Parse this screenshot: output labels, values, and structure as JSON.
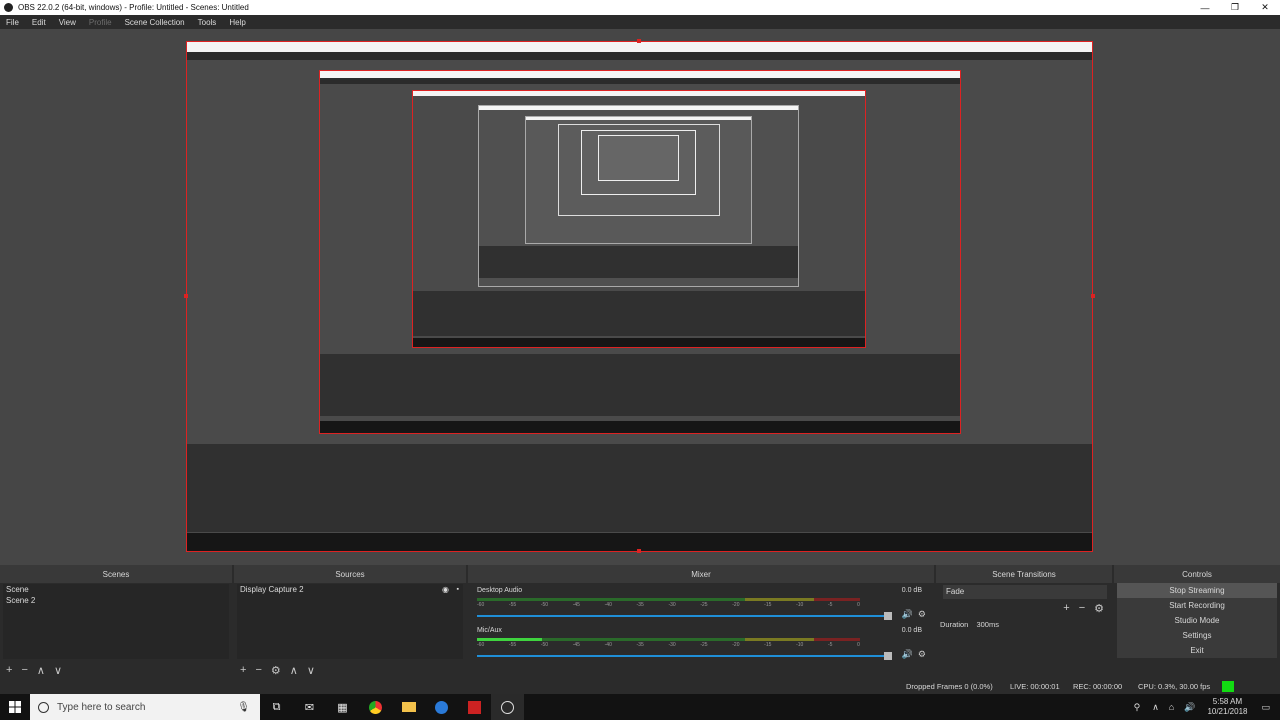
{
  "window": {
    "title": "OBS 22.0.2 (64-bit, windows) - Profile: Untitled - Scenes: Untitled",
    "minimize": "—",
    "maximize": "❐",
    "close": "✕"
  },
  "menu": {
    "file": "File",
    "edit": "Edit",
    "view": "View",
    "profile": "Profile",
    "scene_collection": "Scene Collection",
    "tools": "Tools",
    "help": "Help"
  },
  "scenes": {
    "title": "Scenes",
    "items": [
      "Scene",
      "Scene 2"
    ]
  },
  "sources": {
    "title": "Sources",
    "items": [
      "Display Capture 2"
    ]
  },
  "mixer": {
    "title": "Mixer",
    "channels": [
      {
        "name": "Desktop Audio",
        "db": "0.0 dB"
      },
      {
        "name": "Mic/Aux",
        "db": "0.0 dB"
      }
    ],
    "scale": [
      "-60",
      "-55",
      "-50",
      "-45",
      "-40",
      "-35",
      "-30",
      "-25",
      "-20",
      "-15",
      "-10",
      "-5",
      "0"
    ]
  },
  "transitions": {
    "title": "Scene Transitions",
    "selected": "Fade",
    "duration_label": "Duration",
    "duration_value": "300ms"
  },
  "controls": {
    "title": "Controls",
    "stop_streaming": "Stop Streaming",
    "start_recording": "Start Recording",
    "studio_mode": "Studio Mode",
    "settings": "Settings",
    "exit": "Exit"
  },
  "status": {
    "dropped": "Dropped Frames 0 (0.0%)",
    "live": "LIVE: 00:00:01",
    "rec": "REC: 00:00:00",
    "cpu": "CPU: 0.3%, 30.00 fps"
  },
  "taskbar": {
    "search_placeholder": "Type here to search",
    "time": "5:58 AM",
    "date": "10/21/2018"
  },
  "colors": {
    "accent_red": "#dd2222",
    "live_green": "#12dc12",
    "slider_blue": "#1f8fd8"
  }
}
